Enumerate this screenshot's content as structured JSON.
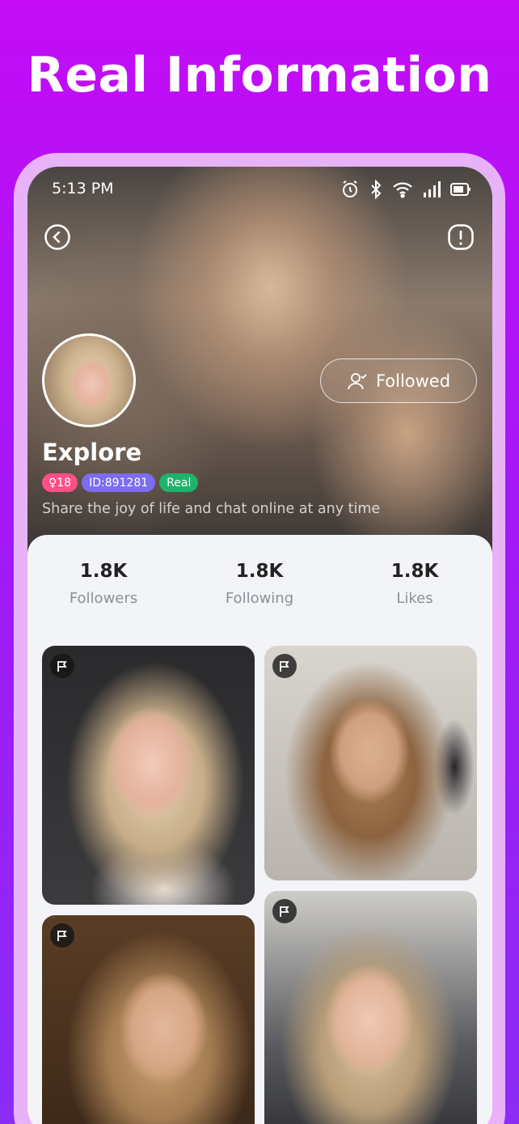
{
  "promo": {
    "title": "Real Information"
  },
  "status_bar": {
    "time": "5:13 PM"
  },
  "nav": {
    "back_icon": "chevron-left-icon",
    "report_icon": "alert-icon"
  },
  "profile": {
    "name": "Explore",
    "follow_label": "Followed",
    "tags": {
      "gender_age": "♀18",
      "id": "ID:891281",
      "real": "Real"
    },
    "bio": "Share the joy of life and chat online at any time"
  },
  "stats": [
    {
      "value": "1.8K",
      "label": "Followers"
    },
    {
      "value": "1.8K",
      "label": "Following"
    },
    {
      "value": "1.8K",
      "label": "Likes"
    }
  ],
  "colors": {
    "background": "#c40cf7",
    "tag_gender": "#ff4f87",
    "tag_id": "#7c6cf2",
    "tag_real": "#1db36b"
  }
}
